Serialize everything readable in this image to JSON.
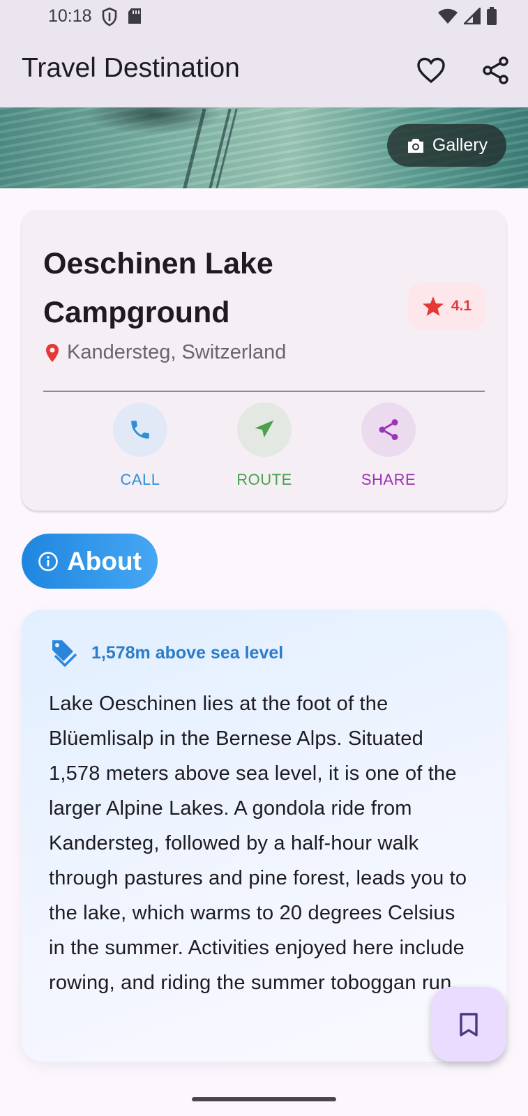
{
  "status_bar": {
    "time": "10:18",
    "left_icons": [
      "shield-icon",
      "sd-card-icon"
    ],
    "right_icons": [
      "wifi-icon",
      "signal-icon",
      "battery-icon"
    ]
  },
  "app_bar": {
    "title": "Travel Destination",
    "actions": [
      "heart-icon",
      "share-icon"
    ]
  },
  "hero": {
    "gallery_label": "Gallery"
  },
  "place": {
    "name": "Oeschinen Lake Campground",
    "rating": "4.1",
    "location": "Kandersteg, Switzerland"
  },
  "actions": [
    {
      "label": "CALL",
      "icon": "phone-icon",
      "color": "#2f8fd9",
      "bg": "#e1e9f7"
    },
    {
      "label": "ROUTE",
      "icon": "navigation-icon",
      "color": "#4aa04e",
      "bg": "#e4e8e2"
    },
    {
      "label": "SHARE",
      "icon": "share-icon",
      "color": "#9c35b5",
      "bg": "#ecdbef"
    }
  ],
  "about": {
    "label": "About",
    "elevation": "1,578m above sea level",
    "description": "Lake Oeschinen lies at the foot of the Blüemlisalp in the Bernese Alps. Situated 1,578 meters above sea level, it is one of the larger Alpine Lakes. A gondola ride from Kandersteg, followed by a half-hour walk through pastures and pine forest, leads you to the lake, which warms to 20 degrees Celsius in the summer. Activities enjoyed here include rowing, and riding the summer toboggan run."
  },
  "colors": {
    "accent_blue": "#2a86dd",
    "rating_red": "#e03b3b",
    "fab_bg": "#eadcff"
  }
}
